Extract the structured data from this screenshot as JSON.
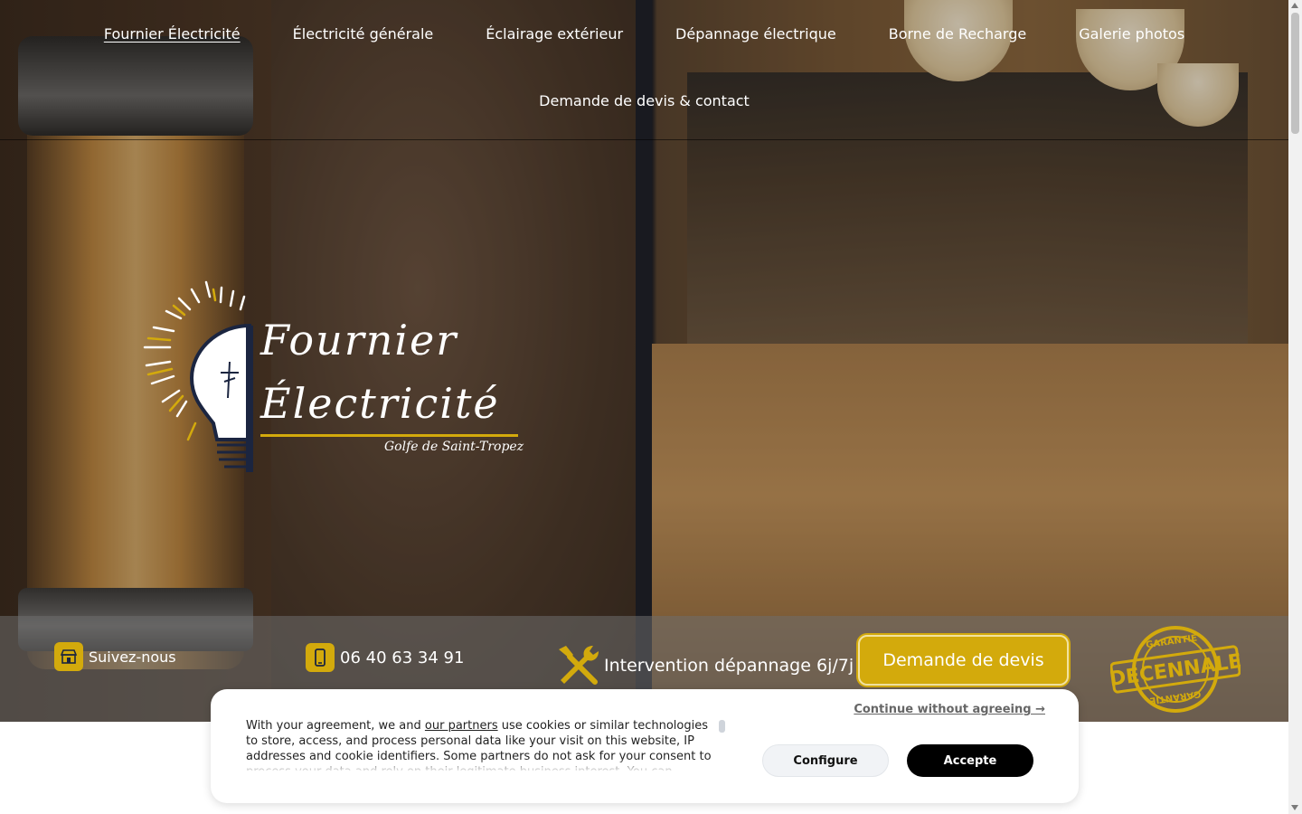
{
  "nav": {
    "row1": [
      "Fournier Électricité",
      "Électricité générale",
      "Éclairage extérieur",
      "Dépannage électrique",
      "Borne de Recharge",
      "Galerie photos"
    ],
    "row2": [
      "Demande de devis & contact"
    ],
    "active_index": 0
  },
  "logo": {
    "line1": "Fournier",
    "line2": "Électricité",
    "subtitle": "Golfe de Saint-Tropez"
  },
  "infobar": {
    "follow_label": "Suivez-nous",
    "phone": "06 40 63 34 91",
    "repair_label": "Intervention dépannage 6j/7j",
    "quote_button": "Demande de devis",
    "badge_top": "GARANTIE",
    "badge_main": "DECENNALE",
    "badge_bottom": "GARANTIE"
  },
  "cookie": {
    "continue_link": "Continue without agreeing →",
    "text_before_link": "With your agreement, we and ",
    "link_text": "our partners",
    "text_after_link": " use cookies or similar technologies to store, access, and process personal data like your visit on this website, IP addresses and cookie identifiers. Some partners do not ask for your consent to process your data and rely on their legitimate business interest. You can",
    "configure_button": "Configure",
    "accept_button": "Accepte"
  },
  "colors": {
    "accent": "#d3aa0c",
    "nav_text": "#ffffff",
    "accept_bg": "#000000"
  },
  "icons": [
    "store-icon",
    "smartphone-icon",
    "tools-icon",
    "lightbulb-icon",
    "badge-icon"
  ]
}
